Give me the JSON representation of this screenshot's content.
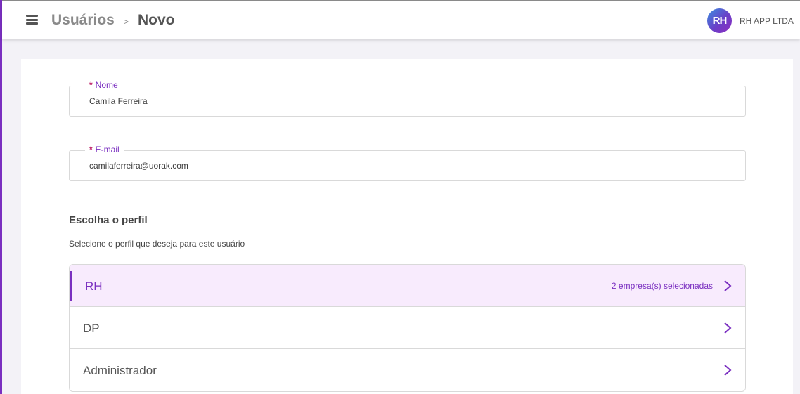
{
  "header": {
    "breadcrumb_parent": "Usuários",
    "breadcrumb_separator": ">",
    "breadcrumb_current": "Novo",
    "avatar_text": "RH",
    "company_name": "RH APP LTDA",
    "menu_icon": "hamburger-icon"
  },
  "form": {
    "name_field": {
      "required_mark": "*",
      "label": "Nome",
      "value": "Camila Ferreira"
    },
    "email_field": {
      "required_mark": "*",
      "label": "E-mail",
      "value": "camilaferreira@uorak.com"
    }
  },
  "profile_section": {
    "title": "Escolha o perfil",
    "subtitle": "Selecione o perfil que deseja para este usuário",
    "items": [
      {
        "label": "RH",
        "selected_count_text": "2 empresa(s) selecionadas",
        "active": true,
        "icon": "chevron-right-icon"
      },
      {
        "label": "DP",
        "selected_count_text": "",
        "active": false,
        "icon": "chevron-right-icon"
      },
      {
        "label": "Administrador",
        "selected_count_text": "",
        "active": false,
        "icon": "chevron-right-icon"
      }
    ]
  },
  "colors": {
    "accent": "#7a2fc0",
    "active_background": "#f8ebfd",
    "required_mark": "#c0246a",
    "page_background": "#f3f2f7"
  }
}
